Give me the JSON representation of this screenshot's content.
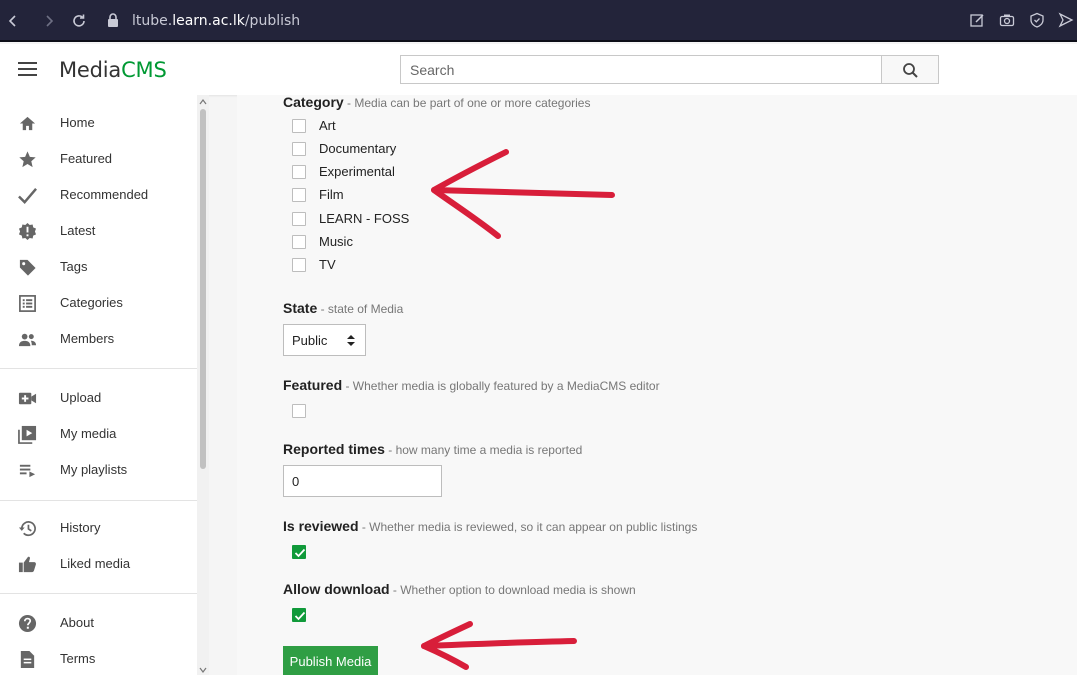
{
  "browser": {
    "url_prefix": "ltube.",
    "url_domain": "learn.ac.lk",
    "url_path": "/publish"
  },
  "header": {
    "logo_main": "Media",
    "logo_accent": "CMS",
    "search_placeholder": "Search"
  },
  "sidebar": {
    "items": [
      {
        "label": "Home",
        "icon": "home-icon"
      },
      {
        "label": "Featured",
        "icon": "star-icon"
      },
      {
        "label": "Recommended",
        "icon": "checkmark-icon"
      },
      {
        "label": "Latest",
        "icon": "latest-badge-icon"
      },
      {
        "label": "Tags",
        "icon": "tag-icon"
      },
      {
        "label": "Categories",
        "icon": "list-icon"
      },
      {
        "label": "Members",
        "icon": "people-icon"
      },
      {
        "label": "Upload",
        "icon": "video-add-icon"
      },
      {
        "label": "My media",
        "icon": "video-library-icon"
      },
      {
        "label": "My playlists",
        "icon": "playlist-icon"
      },
      {
        "label": "History",
        "icon": "history-icon"
      },
      {
        "label": "Liked media",
        "icon": "thumbs-up-icon"
      },
      {
        "label": "About",
        "icon": "help-icon"
      },
      {
        "label": "Terms",
        "icon": "document-icon"
      }
    ]
  },
  "form": {
    "category": {
      "label": "Category",
      "hint": " - Media can be part of one or more categories",
      "options": [
        "Art",
        "Documentary",
        "Experimental",
        "Film",
        "LEARN - FOSS",
        "Music",
        "TV"
      ]
    },
    "state": {
      "label": "State",
      "hint": " - state of Media",
      "selected": "Public"
    },
    "featured": {
      "label": "Featured",
      "hint": " - Whether media is globally featured by a MediaCMS editor",
      "checked": false
    },
    "reported_times": {
      "label": "Reported times",
      "hint": " - how many time a media is reported",
      "value": "0"
    },
    "is_reviewed": {
      "label": "Is reviewed",
      "hint": " - Whether media is reviewed, so it can appear on public listings",
      "checked": true
    },
    "allow_download": {
      "label": "Allow download",
      "hint": " - Whether option to download media is shown",
      "checked": true
    },
    "publish_label": "Publish Media"
  },
  "colors": {
    "accent": "#009933",
    "checkbox_checked": "#109a3a",
    "publish_button": "#2f9e44",
    "annotation_arrow": "#d81e3a",
    "browser_bar": "#23243a"
  }
}
